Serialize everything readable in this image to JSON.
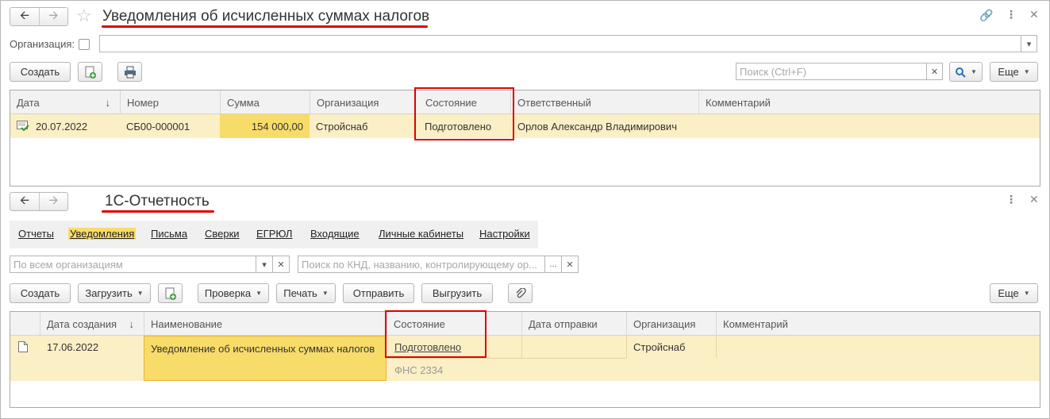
{
  "window1": {
    "title": "Уведомления об исчисленных суммах налогов",
    "org_label": "Организация:",
    "create_label": "Создать",
    "search_placeholder": "Поиск (Ctrl+F)",
    "more_label": "Еще",
    "columns": [
      "Дата",
      "Номер",
      "Сумма",
      "Организация",
      "Состояние",
      "Ответственный",
      "Комментарий"
    ],
    "rows": [
      {
        "date": "20.07.2022",
        "number": "СБ00-000001",
        "sum": "154 000,00",
        "org": "Стройснаб",
        "state": "Подготовлено",
        "responsible": "Орлов Александр Владимирович",
        "comment": ""
      }
    ]
  },
  "window2": {
    "title": "1С-Отчетность",
    "tabs": [
      "Отчеты",
      "Уведомления",
      "Письма",
      "Сверки",
      "ЕГРЮЛ",
      "Входящие",
      "Личные кабинеты",
      "Настройки"
    ],
    "org_placeholder": "По всем организациям",
    "search_placeholder": "Поиск по КНД, названию, контролирующему ор...",
    "buttons": {
      "create": "Создать",
      "load": "Загрузить",
      "check": "Проверка",
      "print": "Печать",
      "send": "Отправить",
      "export": "Выгрузить",
      "more": "Еще"
    },
    "columns": [
      "Дата создания",
      "Наименование",
      "Состояние",
      "Дата отправки",
      "Организация",
      "Комментарий"
    ],
    "rows": [
      {
        "date": "17.06.2022",
        "name": "Уведомление об исчисленных суммах налогов",
        "state": "Подготовлено",
        "recipient": "ФНС 2334",
        "sent": "",
        "org": "Стройснаб",
        "comment": ""
      }
    ]
  },
  "colors": {
    "accent_red": "#e00000",
    "row_highlight": "#fbefc6",
    "active_tab": "#f8dc6a"
  }
}
